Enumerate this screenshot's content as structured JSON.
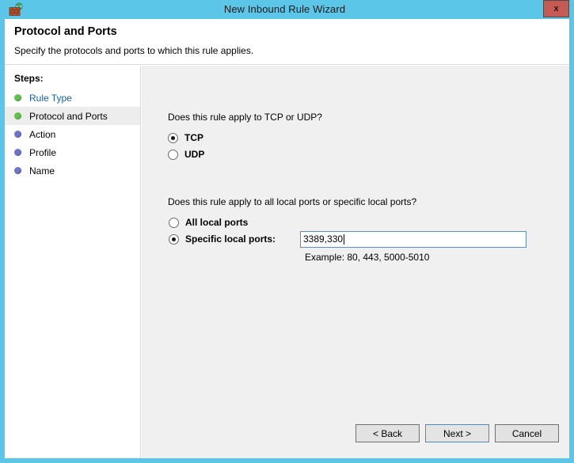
{
  "window": {
    "title": "New Inbound Rule Wizard",
    "icon": "firewall-icon",
    "close_label": "x",
    "accent_color": "#5bc6e8",
    "close_color": "#c75b53"
  },
  "header": {
    "title": "Protocol and Ports",
    "subtitle": "Specify the protocols and ports to which this rule applies."
  },
  "sidebar": {
    "heading": "Steps:",
    "items": [
      {
        "label": "Rule Type",
        "state": "done",
        "bullet_color": "#5fc24d",
        "is_link": true,
        "current": false
      },
      {
        "label": "Protocol and Ports",
        "state": "current",
        "bullet_color": "#5fc24d",
        "is_link": false,
        "current": true
      },
      {
        "label": "Action",
        "state": "pending",
        "bullet_color": "#6f74c9",
        "is_link": false,
        "current": false
      },
      {
        "label": "Profile",
        "state": "pending",
        "bullet_color": "#6f74c9",
        "is_link": false,
        "current": false
      },
      {
        "label": "Name",
        "state": "pending",
        "bullet_color": "#6f74c9",
        "is_link": false,
        "current": false
      }
    ]
  },
  "main": {
    "protocol_question": "Does this rule apply to TCP or UDP?",
    "protocol_options": [
      {
        "label": "TCP",
        "checked": true
      },
      {
        "label": "UDP",
        "checked": false
      }
    ],
    "ports_question": "Does this rule apply to all local ports or specific local ports?",
    "ports_options": [
      {
        "label": "All local ports",
        "checked": false
      },
      {
        "label": "Specific local ports:",
        "checked": true
      }
    ],
    "port_value": "3389,330",
    "port_placeholder": "",
    "example_hint": "Example: 80, 443, 5000-5010"
  },
  "buttons": {
    "back": "< Back",
    "next": "Next >",
    "cancel": "Cancel"
  }
}
